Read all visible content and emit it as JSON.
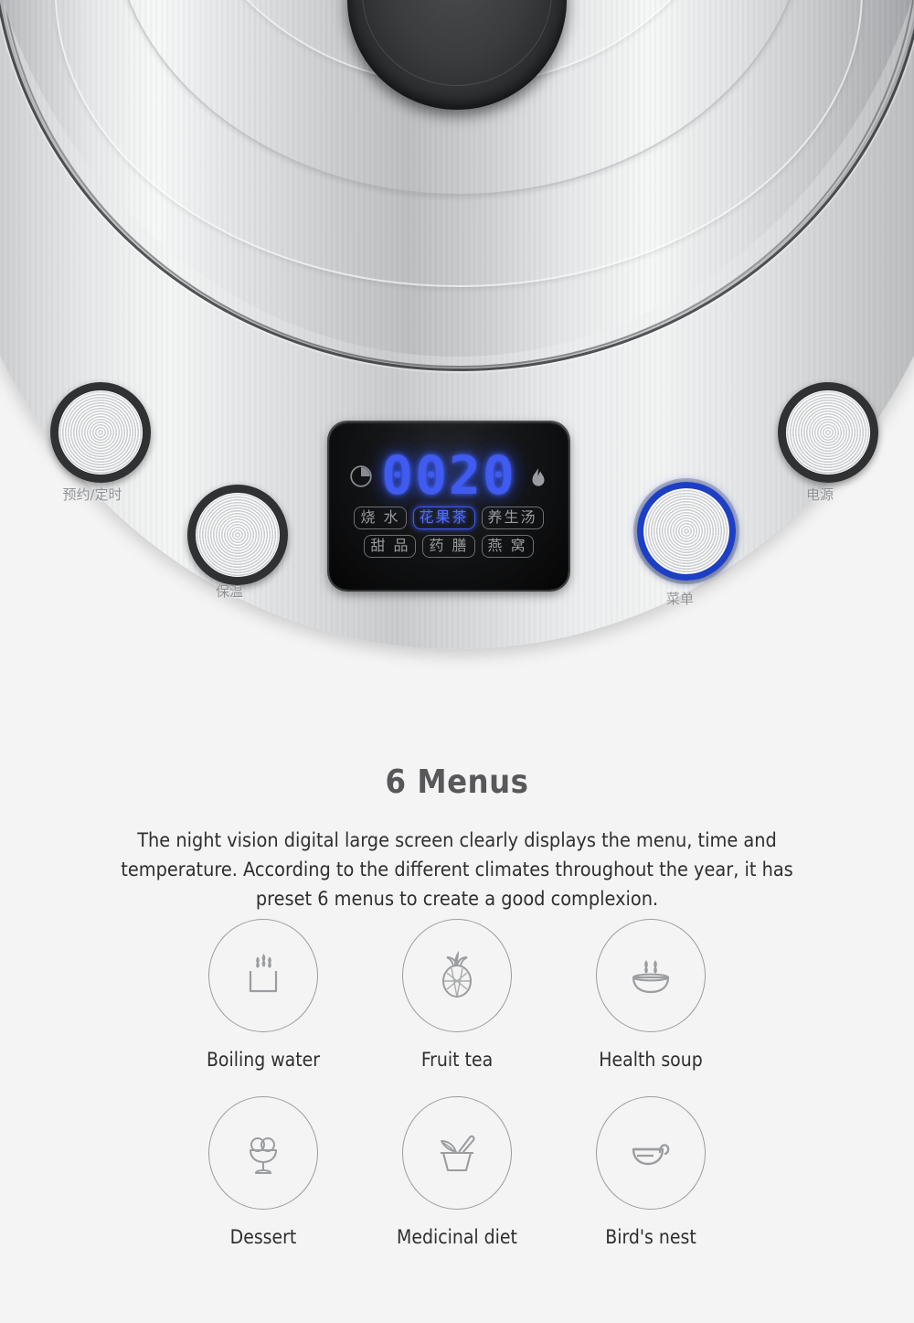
{
  "product": {
    "appliance": "electric-kettle-control-panel",
    "buttons": [
      {
        "id": "timer",
        "label": "预约/定时",
        "state": "off",
        "ring": "dark"
      },
      {
        "id": "keepwarm",
        "label": "保温",
        "state": "off",
        "ring": "dark"
      },
      {
        "id": "menu",
        "label": "菜单",
        "state": "active",
        "ring": "blue"
      },
      {
        "id": "power",
        "label": "电源",
        "state": "off",
        "ring": "dark"
      }
    ],
    "display": {
      "digits": "0020",
      "clock_icon": "clock-icon",
      "flame_icon": "flame-icon",
      "chip_rows": [
        [
          {
            "label": "烧 水",
            "active": false
          },
          {
            "label": "花果茶",
            "active": true
          },
          {
            "label": "养生汤",
            "active": false
          }
        ],
        [
          {
            "label": "甜 品",
            "active": false
          },
          {
            "label": "药 膳",
            "active": false
          },
          {
            "label": "燕 窝",
            "active": false
          }
        ]
      ],
      "active_color": "#3f5bf0",
      "inactive_color": "#9a9c9f"
    }
  },
  "copy": {
    "headline": "6 Menus",
    "paragraph": "The night vision digital large screen clearly displays the menu, time and temperature. According to the different climates throughout the year, it has preset 6 menus to create a good complexion."
  },
  "menu_grid": {
    "rows": [
      [
        {
          "label": "Boiling water",
          "icon": "steaming-cup-icon"
        },
        {
          "label": "Fruit tea",
          "icon": "pineapple-icon"
        },
        {
          "label": "Health soup",
          "icon": "steaming-bowl-icon"
        }
      ],
      [
        {
          "label": "Dessert",
          "icon": "ice-cream-goblet-icon"
        },
        {
          "label": "Medicinal diet",
          "icon": "mortar-pestle-icon"
        },
        {
          "label": "Bird's nest",
          "icon": "ladle-nest-icon"
        }
      ]
    ]
  },
  "colors": {
    "background": "#f4f4f4",
    "heading": "#58585a",
    "body_text": "#2f2f31",
    "led_blue": "#1c3fc6",
    "icon_stroke": "#9b9da0"
  }
}
